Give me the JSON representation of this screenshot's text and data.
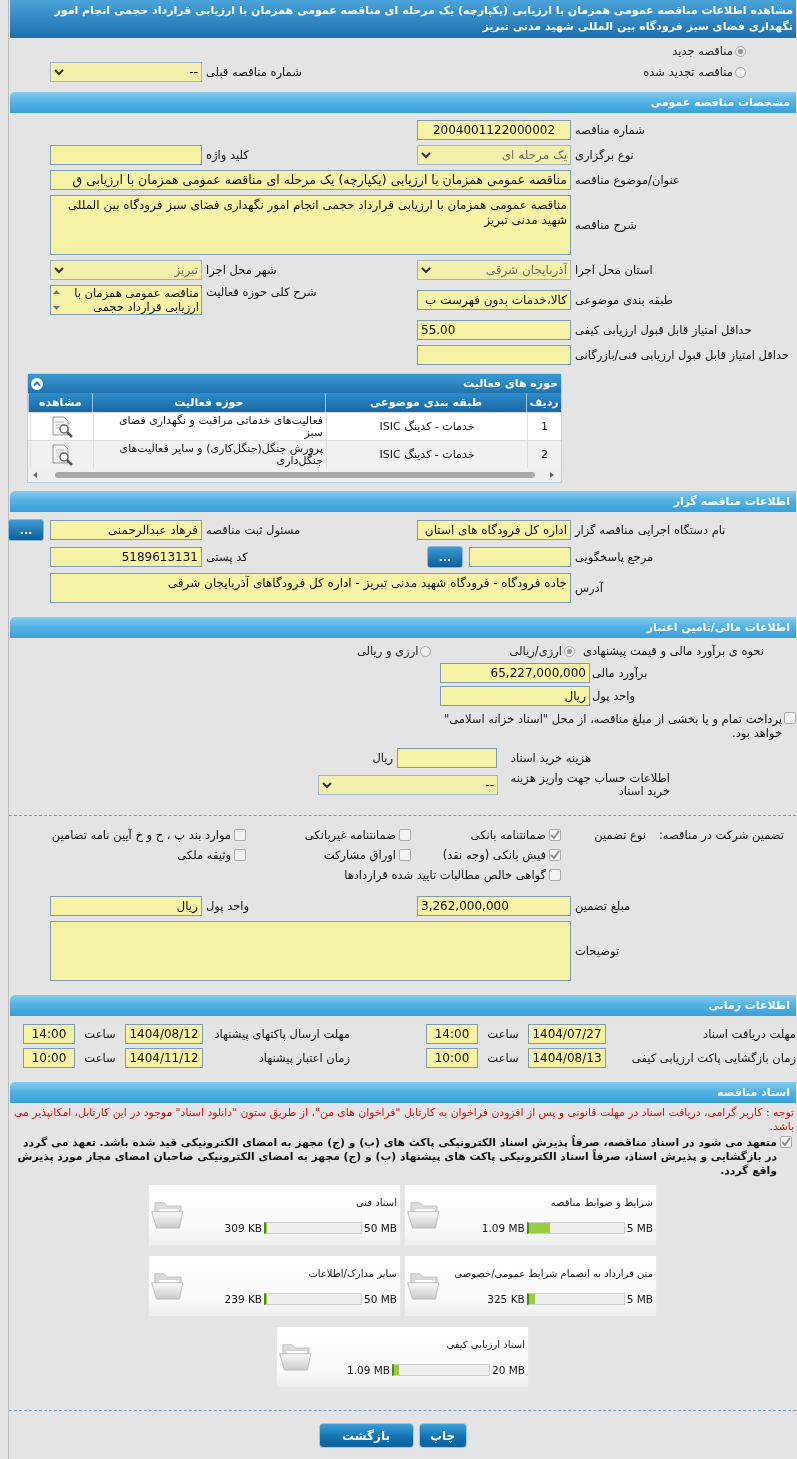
{
  "page_title": "مشاهده اطلاعات مناقصه عمومی همزمان با ارزیابی (یکپارچه) یک مرحله ای مناقصه عمومی همزمان با ارزیابی قرارداد حجمی انجام امور نگهداری فضای سبز فرودگاه بین المللی شهید مدنی تبریز",
  "tender_kind": [
    {
      "label": "مناقصه جدید",
      "selected": true
    },
    {
      "label": "مناقصه تجدید شده",
      "selected": false
    }
  ],
  "previous_tender": {
    "label": "شماره مناقصه قبلی",
    "value": "--",
    "disabled": false
  },
  "general": {
    "title": "مشخصات مناقصه عمومی",
    "tender_number": {
      "label": "شماره مناقصه",
      "value": "2004001122000002"
    },
    "holding_type": {
      "label": "نوع برگزاری",
      "value": "یک مرحله ای",
      "disabled": true
    },
    "keyword": {
      "label": "کلید واژه"
    },
    "subject": {
      "label": "عنوان/موضوع مناقصه",
      "value": "مناقصه عمومی همزمان با ارزیابی (یکپارچه) یک مرحله ای مناقصه عمومی همزمان با ارزیابی ق"
    },
    "description": {
      "label": "شرح مناقصه",
      "value": "مناقصه عمومی همزمان با ارزیابی قرارداد حجمی انجام امور نگهداری فضای سبز فرودگاه بین المللی شهید مدنی تبریز"
    },
    "province": {
      "label": "استان محل اجرا",
      "value": "آذربایجان شرقی",
      "disabled": true
    },
    "city": {
      "label": "شهر محل اجرا",
      "value": "تبریز",
      "disabled": true
    },
    "category": {
      "label": "طبقه بندی موضوعی",
      "value": "کالا،خدمات بدون فهرست ب"
    },
    "activity_summary": {
      "label": "شرح کلی حوزه فعالیت",
      "value": "مناقصه عمومی همزمان با ارزیابی قرارداد حجمی"
    },
    "min_quality_score": {
      "label": "حداقل امتیاز قابل قبول ارزیابی کیفی",
      "value": "55.00"
    },
    "min_technical_score": {
      "label": "حداقل امتیاز قابل قبول ارزیابی فنی/بازرگانی"
    },
    "activity_table": {
      "title": "حوزه های فعالیت",
      "columns": [
        "ردیف",
        "طبقه بندی موضوعی",
        "حوزه فعالیت",
        "مشاهده"
      ],
      "rows": [
        {
          "index": "1",
          "category": "خدمات - کدینگ ISIC",
          "scope": "فعالیت‌های خدماتی مراقبت و نگهداری فضای سبز"
        },
        {
          "index": "2",
          "category": "خدمات - کدینگ ISIC",
          "scope": "پرورش جنگل(جنگل‌کاری) و سایر فعالیت‌های جنگل‌داری"
        }
      ]
    }
  },
  "organizer": {
    "title": "اطلاعات مناقصه گزار",
    "organization": {
      "label": "نام دستگاه اجرایی مناقصه گزار",
      "value": "اداره کل فرودگاه های استان"
    },
    "registrar": {
      "label": "مسئول ثبت مناقصه",
      "value": "فرهاد  عبدالرحمنی",
      "button": "..."
    },
    "reference": {
      "label": "مرجع پاسخگویی",
      "button": "..."
    },
    "postal_code": {
      "label": "کد پستی",
      "value": "5189613131"
    },
    "address": {
      "label": "آدرس",
      "value": "جاده فرودگاه - فرودگاه شهید مدنی تبریز - اداره کل فرودگاهای آذربایجان شرقی"
    }
  },
  "finance": {
    "title": "اطلاعات مالی/تامین اعتبار",
    "estimate_method": {
      "label": "نحوه ی برآورد مالی و قیمت پیشنهادی",
      "options": [
        {
          "label": "ارزی/ریالی",
          "selected": true
        },
        {
          "label": "ارزی و ریالی",
          "selected": false
        }
      ]
    },
    "estimate": {
      "label": "برآورد مالی",
      "value": "65,227,000,000"
    },
    "currency": {
      "label": "واحد پول",
      "value": "ریال"
    },
    "treasury_bonds": {
      "label": "پرداخت تمام و یا بخشی از مبلغ مناقصه، از محل \"اسناد خزانه اسلامی\" خواهد بود.",
      "checked": false
    },
    "document_fee": {
      "label": "هزینه خرید اسناد",
      "unit": "ریال"
    },
    "account": {
      "label": "اطلاعات حساب جهت واریز هزینه خرید اسناد",
      "value": "--",
      "disabled": false
    }
  },
  "guarantee": {
    "heading": "تضمین شرکت در مناقصه:",
    "type_label": "نوع تضمین",
    "options": [
      {
        "label": "ضمانتنامه بانکی",
        "checked": true
      },
      {
        "label": "ضمانتنامه غیربانکی",
        "checked": false
      },
      {
        "label": "موارد بند پ ، ح و خ آیین نامه تضامین",
        "checked": false
      },
      {
        "label": "فیش بانکی (وجه نقد)",
        "checked": true
      },
      {
        "label": "اوراق مشارکت",
        "checked": false
      },
      {
        "label": "وثیقه ملکی",
        "checked": false
      },
      {
        "label": "گواهی خالص مطالبات تایید شده قراردادها",
        "checked": false
      }
    ],
    "amount": {
      "label": "مبلغ تضمین",
      "value": "3,262,000,000"
    },
    "currency": {
      "label": "واحد پول",
      "value": "ریال"
    },
    "notes": {
      "label": "توضیحات"
    }
  },
  "timing": {
    "title": "اطلاعات زمانی",
    "items": [
      {
        "label": "مهلت دریافت اسناد",
        "date": "1404/07/27",
        "time_label": "ساعت",
        "time": "14:00"
      },
      {
        "label": "مهلت ارسال پاکتهای پیشنهاد",
        "date": "1404/08/12",
        "time_label": "ساعت",
        "time": "14:00"
      },
      {
        "label": "زمان بازگشایی پاکت ارزیابی کیفی",
        "date": "1404/08/13",
        "time_label": "ساعت",
        "time": "10:00"
      },
      {
        "label": "زمان اعتبار پیشنهاد",
        "date": "1404/11/12",
        "time_label": "ساعت",
        "time": "10:00"
      }
    ]
  },
  "documents": {
    "title": "اسناد مناقصه",
    "notice": "توجه : کاربر گرامی، دریافت اسناد در مهلت قانونی و پس از افزودن فراخوان به کارتابل \"فراخوان های من\"، از طریق ستون \"دانلود اسناد\" موجود در این کارتابل، امکانپذیر می باشد.",
    "commitment": {
      "label": "متعهد می شود در اسناد مناقصه، صرفاً پذیرش اسناد الکترونیکی پاکت های (ب) و (ج) مجهز به امضای الکترونیکی قید شده باشد. تعهد می گردد در بازگشایی و پذیرش اسناد، صرفاً اسناد الکترونیکی پاکت های پیشنهاد (ب) و (ج) مجهز به امضای الکترونیکی صاحبان امضای مجاز مورد پذیرش واقع گردد.",
      "checked": true
    },
    "files": [
      {
        "name": "شرایط و ضوابط مناقصه",
        "size": "1.09 MB",
        "max": "5 MB",
        "level": 0.22
      },
      {
        "name": "اسناد فنی",
        "size": "309 KB",
        "max": "50 MB",
        "level": 0.01
      },
      {
        "name": "متن قرارداد به انضمام شرایط عمومی/خصوصی",
        "size": "325 KB",
        "max": "5 MB",
        "level": 0.065
      },
      {
        "name": "سایر مدارک/اطلاعات",
        "size": "239 KB",
        "max": "50 MB",
        "level": 0.006
      },
      {
        "name": "اسناد ارزیابی کیفی",
        "size": "1.09 MB",
        "max": "20 MB",
        "level": 0.055
      }
    ]
  },
  "buttons": [
    {
      "label": "چاپ"
    },
    {
      "label": "بازگشت"
    }
  ]
}
